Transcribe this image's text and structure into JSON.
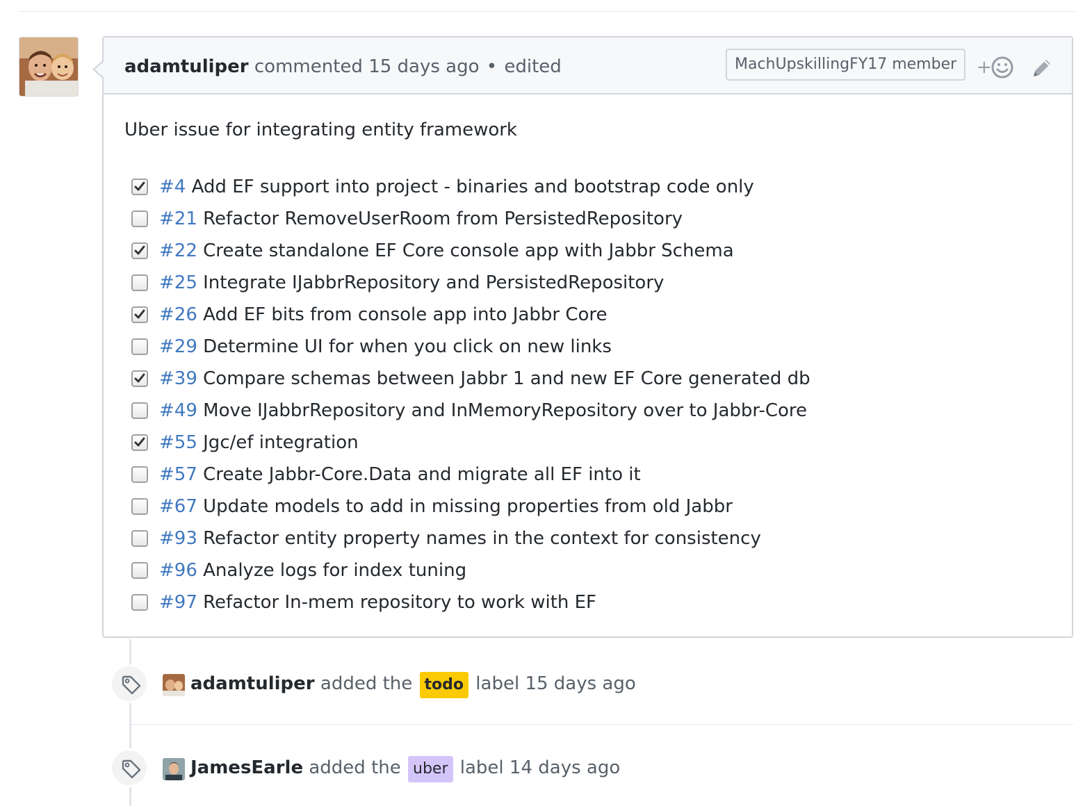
{
  "comment": {
    "author": "adamtuliper",
    "action": "commented",
    "timestamp": "15 days ago",
    "separator": "•",
    "edited_label": "edited",
    "member_badge": "MachUpskillingFY17 member",
    "reaction_plus": "+",
    "intro": "Uber issue for integrating entity framework",
    "tasks": [
      {
        "issue": "#4",
        "text": "Add EF support into project - binaries and bootstrap code only",
        "checked": true
      },
      {
        "issue": "#21",
        "text": "Refactor RemoveUserRoom from PersistedRepository",
        "checked": false
      },
      {
        "issue": "#22",
        "text": "Create standalone EF Core console app with Jabbr Schema",
        "checked": true
      },
      {
        "issue": "#25",
        "text": "Integrate IJabbrRepository and PersistedRepository",
        "checked": false
      },
      {
        "issue": "#26",
        "text": "Add EF bits from console app into Jabbr Core",
        "checked": true
      },
      {
        "issue": "#29",
        "text": "Determine UI for when you click on new links",
        "checked": false
      },
      {
        "issue": "#39",
        "text": "Compare schemas between Jabbr 1 and new EF Core generated db",
        "checked": true
      },
      {
        "issue": "#49",
        "text": "Move IJabbrRepository and InMemoryRepository over to Jabbr-Core",
        "checked": false
      },
      {
        "issue": "#55",
        "text": "Jgc/ef integration",
        "checked": true
      },
      {
        "issue": "#57",
        "text": "Create Jabbr-Core.Data and migrate all EF into it",
        "checked": false
      },
      {
        "issue": "#67",
        "text": "Update models to add in missing properties from old Jabbr",
        "checked": false
      },
      {
        "issue": "#93",
        "text": "Refactor entity property names in the context for consistency",
        "checked": false
      },
      {
        "issue": "#96",
        "text": "Analyze logs for index tuning",
        "checked": false
      },
      {
        "issue": "#97",
        "text": "Refactor In-mem repository to work with EF",
        "checked": false
      }
    ]
  },
  "events": [
    {
      "author": "adamtuliper",
      "action": "added the",
      "label": "todo",
      "label_color": "#fbca04",
      "suffix": "label",
      "timestamp": "15 days ago",
      "icon": "tag-icon"
    },
    {
      "author": "JamesEarle",
      "action": "added the",
      "label": "uber",
      "label_color": "#d4c5f9",
      "suffix": "label",
      "timestamp": "14 days ago",
      "icon": "tag-icon"
    }
  ],
  "colors": {
    "link": "#4078c0",
    "border": "#d1d5da",
    "header_bg": "#f6f8fa"
  }
}
